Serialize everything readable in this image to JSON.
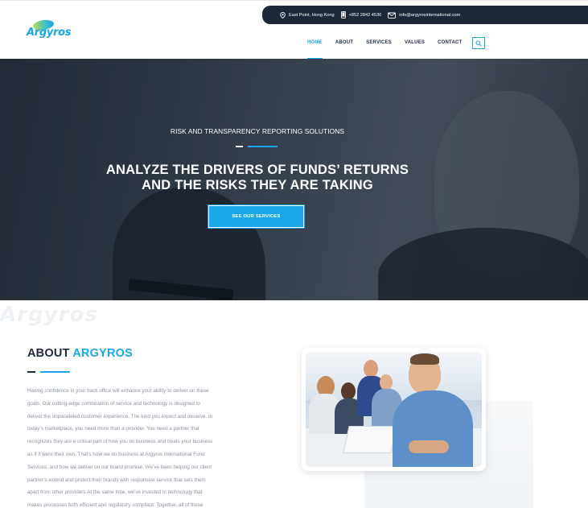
{
  "brand": {
    "logo_text": "Argyros",
    "watermark": "Argyros"
  },
  "topbar": {
    "address": "East Point, Hong Kong",
    "phone": "+852 2842 4530",
    "email": "info@argyrosinternational.com"
  },
  "nav": {
    "items": [
      {
        "label": "HOME",
        "active": true
      },
      {
        "label": "ABOUT",
        "active": false
      },
      {
        "label": "SERVICES",
        "active": false
      },
      {
        "label": "VALUES",
        "active": false
      },
      {
        "label": "CONTACT",
        "active": false
      }
    ],
    "search_icon": "search-icon"
  },
  "hero": {
    "subtitle": "RISK AND TRANSPARENCY REPORTING SOLUTIONS",
    "title_line1": "ANALYZE THE DRIVERS OF FUNDS’ RETURNS",
    "title_line2": "AND THE RISKS THEY ARE TAKING",
    "button_label": "SEE OUR SERVICES"
  },
  "about": {
    "title_prefix": "ABOUT",
    "title_accent": "ARGYROS",
    "body_lines": [
      "Having confidence in your back office will enhance your ability to deliver on these",
      "goals. Our cutting-edge combination of service and technology is designed to",
      "deliver the unparalleled customer experience. The kind you expect and deserve. In",
      "today’s marketplace, you need more than a provider. You need a partner that",
      "recognizes they are a critical part of how you do business and treats your business",
      "as if it were their own. That’s how we do business at Argyros International Fund",
      "Services, and how we deliver on our brand promise. We’ve been helping our client",
      "partner’s extend and protect their brands with responsive service that sets them",
      "apart from other providers.At the same time, we’ve invested in technology that",
      "makes processes both efficient and regulatory compliant. Together, all of these"
    ]
  },
  "colors": {
    "accent": "#19a7e8",
    "navy": "#1d2b45",
    "topbar": "#1c2737"
  }
}
